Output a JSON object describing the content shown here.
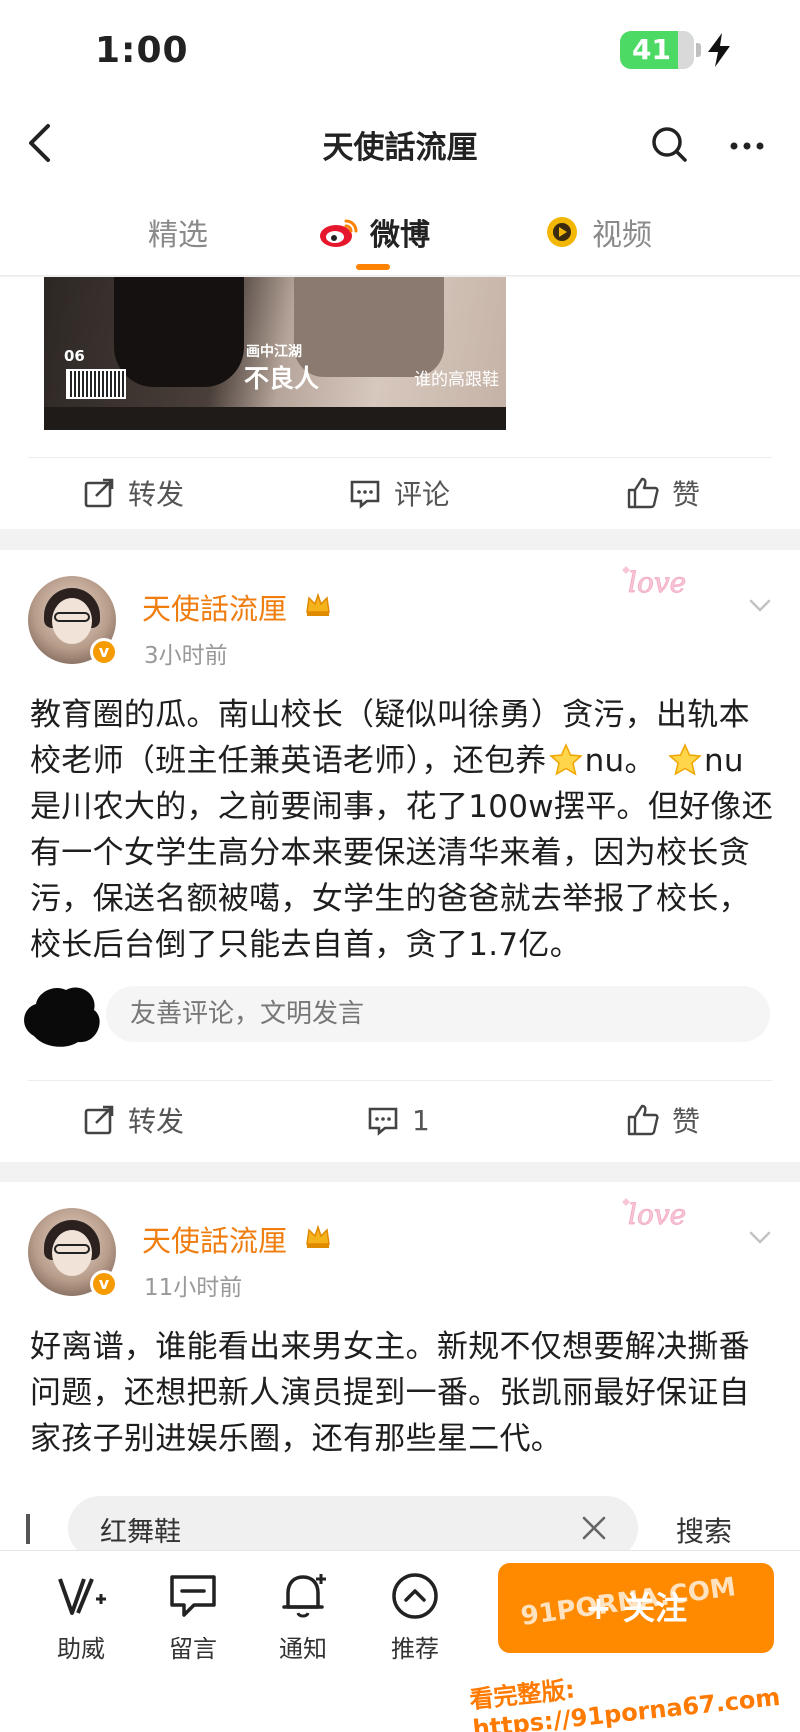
{
  "status_bar": {
    "time": "1:00",
    "battery": "41"
  },
  "nav": {
    "title": "天使話流厘"
  },
  "tabs": [
    {
      "label": "精选"
    },
    {
      "label": "微博"
    },
    {
      "label": "视频"
    }
  ],
  "top_card": {
    "cover": {
      "issue": "06",
      "line1": "画中江湖",
      "line2": "不良人",
      "line3": "谁的高跟鞋"
    },
    "actions": {
      "repost": "转发",
      "comment": "评论",
      "like": "赞"
    }
  },
  "posts": [
    {
      "user": "天使話流厘",
      "time": "3小时前",
      "text_1": "教育圈的瓜。南山校长（疑似叫徐勇）贪污，出轨本校老师（班主任兼英语老师），还包养",
      "text_2": "nu。",
      "text_3": "nu是川农大的，之前要闹事，花了100w摆平。但好像还有一个女学生高分本来要保送清华来着，因为校长贪污，保送名额被噶，女学生的爸爸就去举报了校长，校长后台倒了只能去自首，贪了1.7亿。",
      "comment_placeholder": "友善评论，文明发言",
      "actions": {
        "repost": "转发",
        "comment": "1",
        "like": "赞"
      }
    },
    {
      "user": "天使話流厘",
      "time": "11小时前",
      "text": "好离谱，谁能看出来男女主。新规不仅想要解决撕番问题，还想把新人演员提到一番。张凯丽最好保证自家孩子别进娱乐圈，还有那些星二代。"
    }
  ],
  "search_overlay": {
    "query": "红舞鞋",
    "button": "搜索"
  },
  "bottom_bar": {
    "items": [
      {
        "label": "助威"
      },
      {
        "label": "留言"
      },
      {
        "label": "通知"
      },
      {
        "label": "推荐"
      }
    ],
    "follow": "+ 关注"
  },
  "watermark": {
    "site": "91PORNA.COM",
    "url": "看完整版: https://91porna67.com"
  },
  "colors": {
    "accent": "#ff8200",
    "username": "#ef7d10",
    "battery": "#4cd964"
  }
}
